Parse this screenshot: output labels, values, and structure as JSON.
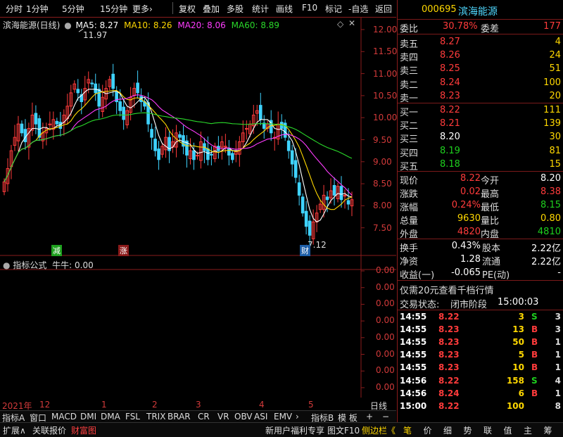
{
  "toolbar": {
    "items": [
      "分时",
      "1分钟",
      "5分钟",
      "15分钟",
      "更多›",
      "复权",
      "叠加",
      "多股",
      "统计",
      "画线",
      "F10",
      "标记",
      "-自选",
      "返回"
    ]
  },
  "chart": {
    "title": "滨海能源(日线)",
    "ma": [
      {
        "label": "MA5: 8.27",
        "color": "#ffffff"
      },
      {
        "label": "MA10: 8.26",
        "color": "#ffd800"
      },
      {
        "label": "MA20: 8.06",
        "color": "#ff3cff"
      },
      {
        "label": "MA60: 8.89",
        "color": "#2ad82a"
      }
    ],
    "price_axis": [
      "12.00",
      "11.50",
      "11.00",
      "10.50",
      "10.00",
      "9.50",
      "9.00",
      "8.50",
      "8.00",
      "7.50"
    ],
    "high_label": "11.97",
    "low_label": "7.12",
    "markers": [
      {
        "text": "减",
        "color": "#1ea01e"
      },
      {
        "text": "涨",
        "color": "#a02020"
      },
      {
        "text": "财",
        "color": "#2060a0"
      }
    ],
    "indicator_title": "指标公式",
    "indicator_name": "牛牛: 0.00",
    "indicator_axis": [
      "0.00",
      "0.00",
      "0.00",
      "0.00",
      "0.00",
      "0.00",
      "0.00",
      "0.00"
    ],
    "time_labels": [
      "2021年",
      "12",
      "1",
      "2",
      "3",
      "4",
      "5"
    ],
    "period": "日线"
  },
  "chart_data": {
    "type": "candlestick",
    "title": "滨海能源(日线)",
    "ylim": [
      7.2,
      12.1
    ],
    "high": 11.97,
    "low": 7.12,
    "closes": [
      8.6,
      8.9,
      9.3,
      9.6,
      9.9,
      9.7,
      9.5,
      9.8,
      10.1,
      9.9,
      9.6,
      9.7,
      9.8,
      9.9,
      10.0,
      9.9,
      9.8,
      10.1,
      10.3,
      10.6,
      10.8,
      10.6,
      10.4,
      10.7,
      10.9,
      10.8,
      10.6,
      10.3,
      10.5,
      10.7,
      10.9,
      10.7,
      10.4,
      10.2,
      10.0,
      10.2,
      10.5,
      10.7,
      10.6,
      10.4,
      10.3,
      9.9,
      9.6,
      9.3,
      9.1,
      9.4,
      9.6,
      9.3,
      9.5,
      9.7,
      9.6,
      9.4,
      9.2,
      9.3,
      9.1,
      9.2,
      9.5,
      9.3,
      9.1,
      9.2,
      9.4,
      9.3,
      9.5,
      9.4,
      9.2,
      9.1,
      9.3,
      9.5,
      9.7,
      9.8,
      9.9,
      10.1,
      10.2,
      10.0,
      9.8,
      9.9,
      9.7,
      9.6,
      9.9,
      9.8,
      9.6,
      9.3,
      9.0,
      8.7,
      8.3,
      7.9,
      7.6,
      7.4,
      7.7,
      7.9,
      8.1,
      8.3,
      8.2,
      8.4,
      8.3,
      8.5,
      8.2,
      8.3,
      8.1,
      8.2
    ],
    "ma5": {
      "name": "MA5",
      "last": 8.27
    },
    "ma10": {
      "name": "MA10",
      "last": 8.26
    },
    "ma20": {
      "name": "MA20",
      "last": 8.06
    },
    "ma60": {
      "name": "MA60",
      "last": 8.89
    }
  },
  "quote": {
    "code": "000695",
    "name": "滨海能源",
    "weibi_label": "委比",
    "weibi": "30.78%",
    "weicha_label": "委差",
    "weicha": "177",
    "asks": [
      {
        "label": "卖五",
        "price": "8.27",
        "vol": "4"
      },
      {
        "label": "卖四",
        "price": "8.26",
        "vol": "24"
      },
      {
        "label": "卖三",
        "price": "8.25",
        "vol": "51"
      },
      {
        "label": "卖二",
        "price": "8.24",
        "vol": "100"
      },
      {
        "label": "卖一",
        "price": "8.23",
        "vol": "20"
      }
    ],
    "bids": [
      {
        "label": "买一",
        "price": "8.22",
        "vol": "111"
      },
      {
        "label": "买二",
        "price": "8.21",
        "vol": "139"
      },
      {
        "label": "买三",
        "price": "8.20",
        "vol": "30"
      },
      {
        "label": "买四",
        "price": "8.19",
        "vol": "81"
      },
      {
        "label": "买五",
        "price": "8.18",
        "vol": "15"
      }
    ],
    "stats": [
      {
        "l1": "现价",
        "v1": "8.22",
        "l2": "今开",
        "v2": "8.20",
        "c1": "red",
        "c2": "white"
      },
      {
        "l1": "涨跌",
        "v1": "0.02",
        "l2": "最高",
        "v2": "8.38",
        "c1": "red",
        "c2": "red"
      },
      {
        "l1": "涨幅",
        "v1": "0.24%",
        "l2": "最低",
        "v2": "8.15",
        "c1": "red",
        "c2": "green"
      },
      {
        "l1": "总量",
        "v1": "9630",
        "l2": "量比",
        "v2": "0.80",
        "c1": "yellow",
        "c2": "yellow"
      },
      {
        "l1": "外盘",
        "v1": "4820",
        "l2": "内盘",
        "v2": "4810",
        "c1": "red",
        "c2": "green"
      }
    ],
    "fund": [
      {
        "l1": "换手",
        "v1": "0.43%",
        "l2": "股本",
        "v2": "2.22亿"
      },
      {
        "l1": "净资",
        "v1": "1.28",
        "l2": "流通",
        "v2": "2.22亿"
      },
      {
        "l1": "收益(一)",
        "v1": "-0.065",
        "l2": "PE(动)",
        "v2": "-"
      }
    ],
    "promo": "仅需20元查看千档行情",
    "trade_status_label": "交易状态:",
    "trade_status": "闭市阶段",
    "trade_time": "15:00:03",
    "ticks": [
      {
        "t": "14:55",
        "p": "8.22",
        "v": "3",
        "s": "S",
        "n": "3"
      },
      {
        "t": "14:55",
        "p": "8.23",
        "v": "13",
        "s": "B",
        "n": "3"
      },
      {
        "t": "14:55",
        "p": "8.23",
        "v": "50",
        "s": "B",
        "n": "1"
      },
      {
        "t": "14:55",
        "p": "8.23",
        "v": "5",
        "s": "B",
        "n": "1"
      },
      {
        "t": "14:55",
        "p": "8.23",
        "v": "10",
        "s": "B",
        "n": "1"
      },
      {
        "t": "14:56",
        "p": "8.22",
        "v": "158",
        "s": "S",
        "n": "4"
      },
      {
        "t": "14:56",
        "p": "8.24",
        "v": "6",
        "s": "B",
        "n": "1"
      },
      {
        "t": "15:00",
        "p": "8.22",
        "v": "100",
        "s": "",
        "n": "8"
      }
    ]
  },
  "indicator_tabs": [
    "指标A",
    "窗口",
    "MACD",
    "DMI",
    "DMA",
    "FSL",
    "TRIX",
    "BRAR",
    "CR",
    "VR",
    "OBV",
    "ASI",
    "EMV",
    "›",
    "指标B",
    "模 板",
    "+",
    "−"
  ],
  "bottom": {
    "left": [
      "扩展∧",
      "关联报价",
      "财富图"
    ],
    "right": [
      "新用户福利专享",
      "图文F10",
      "侧边栏《"
    ],
    "tabs": [
      "笔",
      "价",
      "细",
      "势",
      "联",
      "值",
      "主",
      "筹"
    ]
  }
}
